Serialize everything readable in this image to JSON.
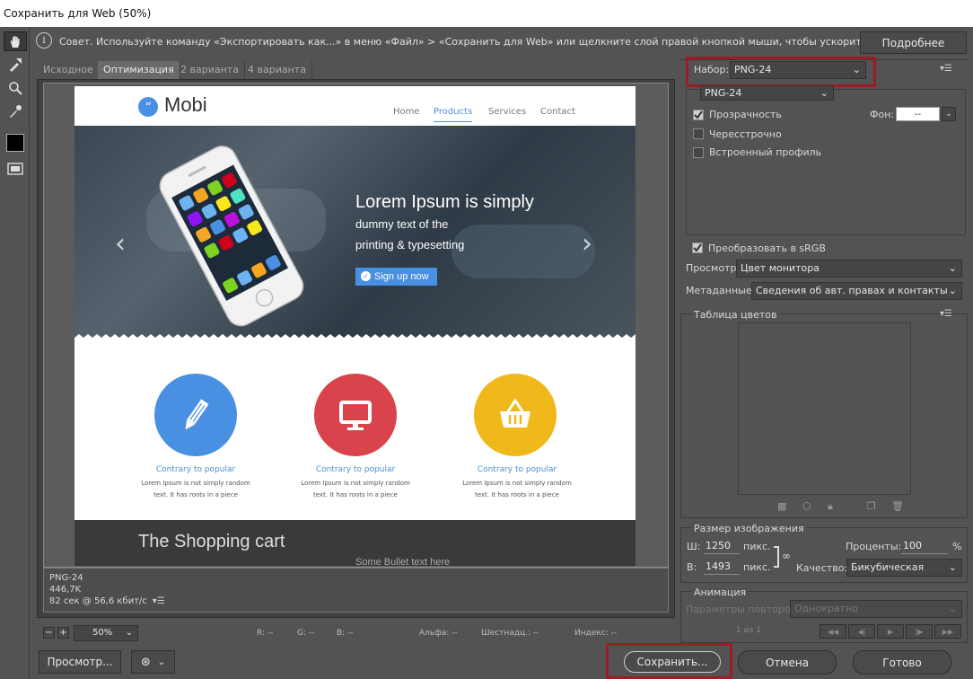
{
  "window": {
    "title": "Сохранить для Web (50%)"
  },
  "tip": {
    "text": "Совет. Используйте команду «Экспортировать как...» в меню «Файл» > «Сохранить для Web» или щелкните слой правой кнопкой мыши, чтобы ускорить экспорт ресурсов",
    "more_label": "Подробнее"
  },
  "tabs": [
    {
      "label": "Исходное"
    },
    {
      "label": "Оптимизация"
    },
    {
      "label": "2 варианта"
    },
    {
      "label": "4 варианта"
    }
  ],
  "preview": {
    "logo": "Mobi",
    "nav": [
      "Home",
      "Products",
      "Services",
      "Contact"
    ],
    "hero_title": "Lorem Ipsum is simply",
    "hero_line1": "dummy text of the",
    "hero_line2": "printing & typesetting",
    "hero_button": "Sign up now",
    "features": [
      {
        "caption": "Contrary to popular",
        "desc1": "Lorem Ipsum is not simply random",
        "desc2": "text. It has roots in a piece",
        "color": "#4a90e2",
        "icon": "pencil-icon"
      },
      {
        "caption": "Contrary to popular",
        "desc1": "Lorem Ipsum is not simply random",
        "desc2": "text. It has roots in a piece",
        "color": "#d9434b",
        "icon": "monitor-icon"
      },
      {
        "caption": "Contrary to popular",
        "desc1": "Lorem Ipsum is not simply random",
        "desc2": "text. It has roots in a piece",
        "color": "#f0b81b",
        "icon": "basket-icon"
      }
    ],
    "cart_title": "The Shopping cart",
    "cart_sub": "Some Bullet text here"
  },
  "info": {
    "format": "PNG-24",
    "size": "446,7K",
    "time": "82 сек @ 56,6 кбит/с"
  },
  "status": {
    "zoom": "50%",
    "r": "R: --",
    "g": "G: --",
    "b": "B: --",
    "alpha": "Альфа: --",
    "hex": "Шестнадц.: --",
    "index": "Индекс: --"
  },
  "settings": {
    "preset_label": "Набор:",
    "preset_value": "PNG-24",
    "format_value": "PNG-24",
    "transparency_label": "Прозрачность",
    "transparency_checked": true,
    "matte_label": "Фон:",
    "matte_value": "--",
    "interlaced_label": "Чересстрочно",
    "embed_profile_label": "Встроенный профиль",
    "convert_srgb_label": "Преобразовать в sRGB",
    "preview_label": "Просмотр:",
    "preview_value": "Цвет монитора",
    "metadata_label": "Метаданные:",
    "metadata_value": "Сведения об авт. правах и контакты",
    "color_table_label": "Таблица цветов",
    "image_size_label": "Размер изображения",
    "w_label": "Ш:",
    "w_value": "1250",
    "h_label": "В:",
    "h_value": "1493",
    "px_unit": "пикс.",
    "percent_label": "Проценты:",
    "percent_value": "100",
    "percent_sign": "%",
    "quality_label": "Качество:",
    "quality_value": "Бикубическая",
    "animation_label": "Анимация",
    "loop_label": "Параметры повторов:",
    "loop_value": "Однократно",
    "frame_counter": "1 из 1"
  },
  "buttons": {
    "preview": "Просмотр...",
    "save": "Сохранить...",
    "cancel": "Отмена",
    "done": "Готово"
  },
  "colors": {
    "highlight": "#9e1c25",
    "accent": "#4a90e2"
  }
}
